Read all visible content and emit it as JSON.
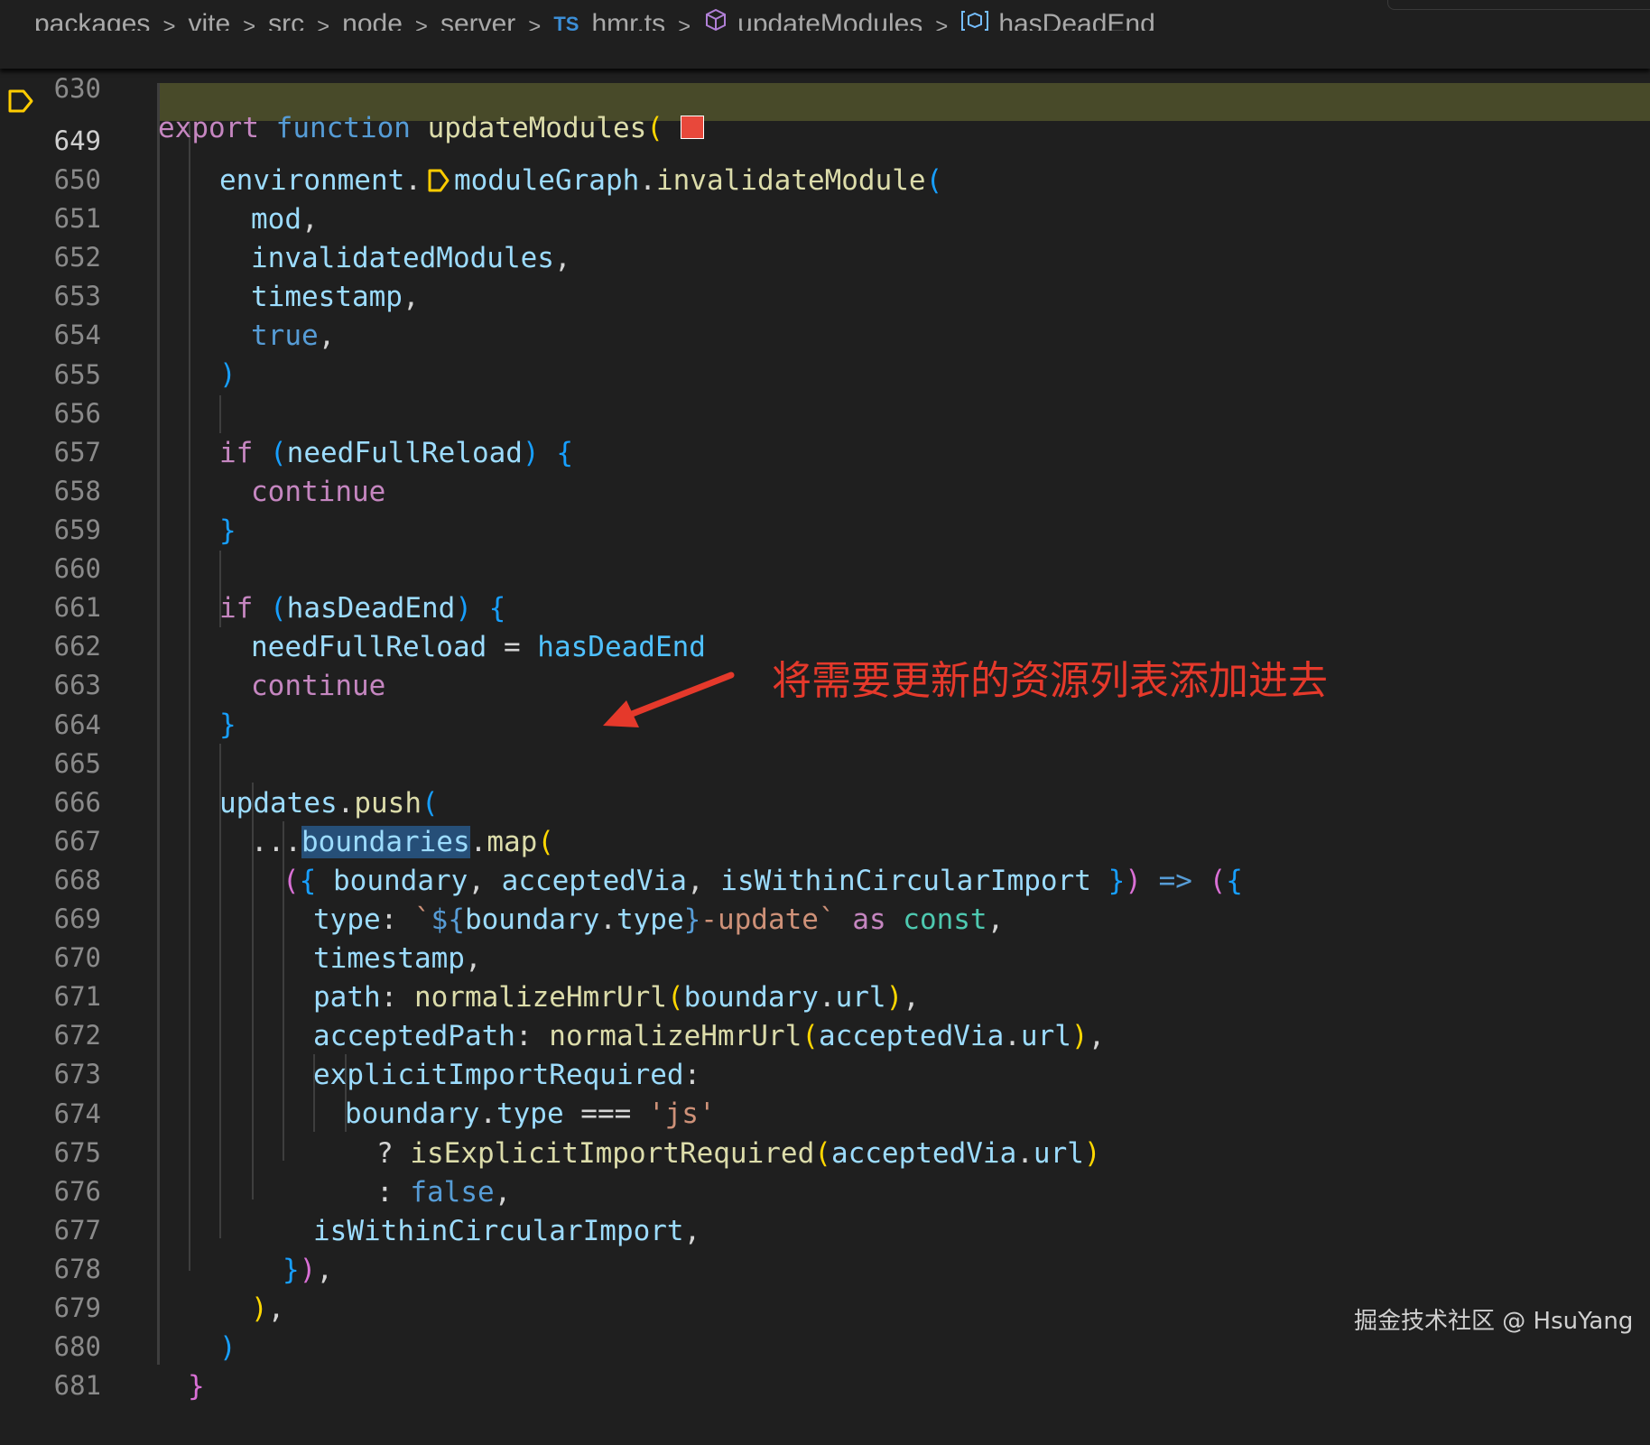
{
  "breadcrumb": {
    "items": [
      "packages",
      "vite",
      "src",
      "node",
      "server",
      "hmr.ts",
      "updateModules",
      "hasDeadEnd"
    ],
    "ts_badge": "TS"
  },
  "sticky": {
    "line_number": "630",
    "tokens": [
      "export",
      "function",
      "updateModules",
      "("
    ]
  },
  "lines": [
    {
      "n": "649"
    },
    {
      "n": "650"
    },
    {
      "n": "651"
    },
    {
      "n": "652"
    },
    {
      "n": "653"
    },
    {
      "n": "654"
    },
    {
      "n": "655"
    },
    {
      "n": "656"
    },
    {
      "n": "657"
    },
    {
      "n": "658"
    },
    {
      "n": "659"
    },
    {
      "n": "660"
    },
    {
      "n": "661"
    },
    {
      "n": "662"
    },
    {
      "n": "663"
    },
    {
      "n": "664"
    },
    {
      "n": "665"
    },
    {
      "n": "666"
    },
    {
      "n": "667"
    },
    {
      "n": "668"
    },
    {
      "n": "669"
    },
    {
      "n": "670"
    },
    {
      "n": "671"
    },
    {
      "n": "672"
    },
    {
      "n": "673"
    },
    {
      "n": "674"
    },
    {
      "n": "675"
    },
    {
      "n": "676"
    },
    {
      "n": "677"
    },
    {
      "n": "678"
    },
    {
      "n": "679"
    },
    {
      "n": "680"
    },
    {
      "n": "681"
    }
  ],
  "code": {
    "l649": [
      "environment",
      ".",
      "moduleGraph",
      ".",
      "invalidateModule",
      "("
    ],
    "l650": [
      "mod",
      ","
    ],
    "l651": [
      "invalidatedModules",
      ","
    ],
    "l652": [
      "timestamp",
      ","
    ],
    "l653": [
      "true",
      ","
    ],
    "l654": [
      ")"
    ],
    "l656": [
      "if",
      " ",
      "(",
      "needFullReload",
      ")",
      " ",
      "{"
    ],
    "l657": [
      "continue"
    ],
    "l658": [
      "}"
    ],
    "l660": [
      "if",
      " ",
      "(",
      "hasDeadEnd",
      ")",
      " ",
      "{"
    ],
    "l661": [
      "needFullReload",
      " = ",
      "hasDeadEnd"
    ],
    "l662": [
      "continue"
    ],
    "l663": [
      "}"
    ],
    "l665": [
      "updates",
      ".",
      "push",
      "("
    ],
    "l666": [
      "...",
      "boundaries",
      ".",
      "map",
      "("
    ],
    "l667": [
      "(",
      "{",
      " boundary",
      ", ",
      "acceptedVia",
      ", ",
      "isWithinCircularImport",
      " ",
      "}",
      ")",
      " => ",
      "(",
      "{"
    ],
    "l668": [
      "type",
      ": ",
      "`",
      "${",
      "boundary",
      ".",
      "type",
      "}",
      "-update",
      "`",
      " as ",
      "const",
      ","
    ],
    "l669": [
      "timestamp",
      ","
    ],
    "l670": [
      "path",
      ": ",
      "normalizeHmrUrl",
      "(",
      "boundary",
      ".",
      "url",
      ")",
      ","
    ],
    "l671": [
      "acceptedPath",
      ": ",
      "normalizeHmrUrl",
      "(",
      "acceptedVia",
      ".",
      "url",
      ")",
      ","
    ],
    "l672": [
      "explicitImportRequired",
      ":"
    ],
    "l673": [
      "boundary",
      ".",
      "type",
      " === ",
      "'js'"
    ],
    "l674": [
      "? ",
      "isExplicitImportRequired",
      "(",
      "acceptedVia",
      ".",
      "url",
      ")"
    ],
    "l675": [
      ": ",
      "false",
      ","
    ],
    "l676": [
      "isWithinCircularImport",
      ","
    ],
    "l677": [
      "}",
      ")",
      ","
    ],
    "l678": [
      ")",
      ","
    ],
    "l679": [
      ")"
    ],
    "l680": [
      "}"
    ]
  },
  "annotation": "将需要更新的资源列表添加进去",
  "watermark": "掘金技术社区 @ HsuYang",
  "colors": {
    "background": "#1f1f1f",
    "highlight_line": "#484a29",
    "annotation": "#e5392b",
    "keyword": "#c586c0",
    "function": "#dcdcaa",
    "variable": "#9cdcfe",
    "string": "#ce9178"
  },
  "icons": [
    "chevron-right-icon",
    "typescript-file-icon",
    "method-cube-icon",
    "variable-icon",
    "breakpoint-icon",
    "color-swatch-icon",
    "annotation-arrow-icon"
  ]
}
